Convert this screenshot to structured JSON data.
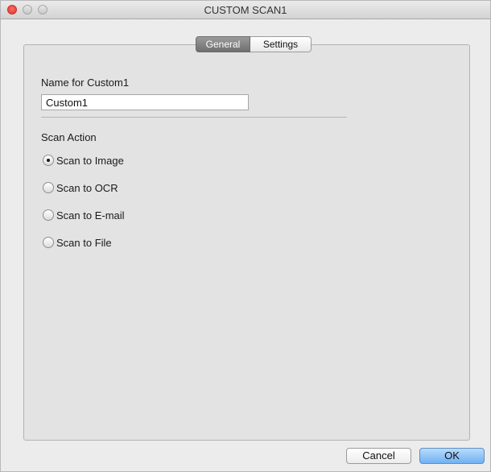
{
  "window": {
    "title": "CUSTOM SCAN1"
  },
  "tabs": [
    {
      "label": "General",
      "active": true
    },
    {
      "label": "Settings",
      "active": false
    }
  ],
  "name_section": {
    "label": "Name for Custom1",
    "value": "Custom1"
  },
  "scan_action": {
    "label": "Scan Action",
    "options": [
      {
        "label": "Scan to Image",
        "checked": true
      },
      {
        "label": "Scan to OCR",
        "checked": false
      },
      {
        "label": "Scan to E-mail",
        "checked": false
      },
      {
        "label": "Scan to File",
        "checked": false
      }
    ]
  },
  "buttons": {
    "cancel": "Cancel",
    "ok": "OK"
  },
  "colors": {
    "close_button": "#ff5f57",
    "default_button": "#7fbaf5",
    "active_tab": "#808080"
  }
}
